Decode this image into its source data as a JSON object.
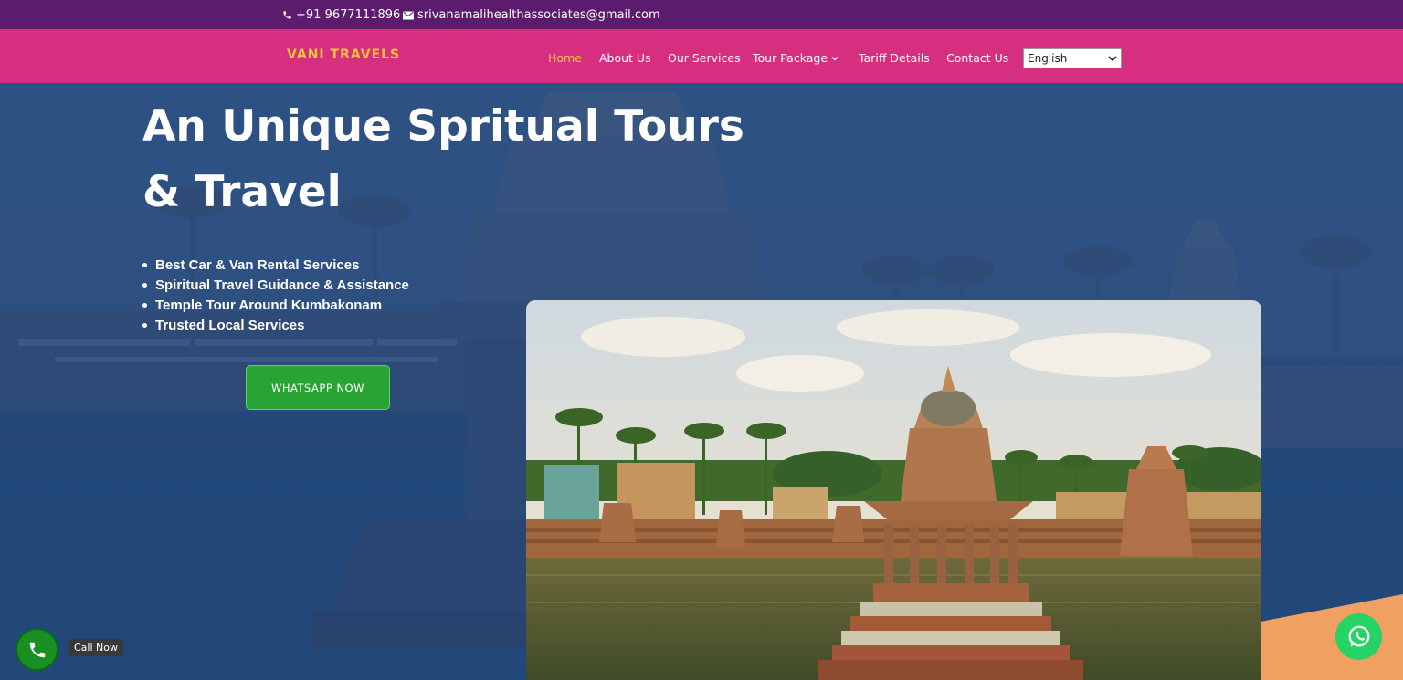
{
  "topbar": {
    "phone": "+91 9677111896",
    "email": "srivanamalihealthassociates@gmail.com",
    "background": "#5c1b6c"
  },
  "nav": {
    "logo": "VANI TRAVELS",
    "background": "#d62f80",
    "items": [
      {
        "label": "Home",
        "active": true
      },
      {
        "label": "About Us"
      },
      {
        "label": "Our Services"
      },
      {
        "label": "Tour Package",
        "has_dropdown": true
      },
      {
        "label": "Tariff Details"
      },
      {
        "label": "Contact Us"
      }
    ],
    "language_selected": "English"
  },
  "hero": {
    "title": "An Unique Spritual Tours & Travel",
    "bullets": [
      "Best Car & Van Rental Services",
      "Spiritual Travel Guidance & Assistance",
      "Temple Tour Around Kumbakonam",
      "Trusted Local Services"
    ],
    "cta": "WHATSAPP NOW",
    "cta_color": "#2aa335"
  },
  "floating": {
    "call_label": "Call Now",
    "call_icon": "phone-icon",
    "whatsapp_icon": "whatsapp-icon",
    "whatsapp_color": "#25d366"
  },
  "colors": {
    "accent": "#f5c33b"
  }
}
